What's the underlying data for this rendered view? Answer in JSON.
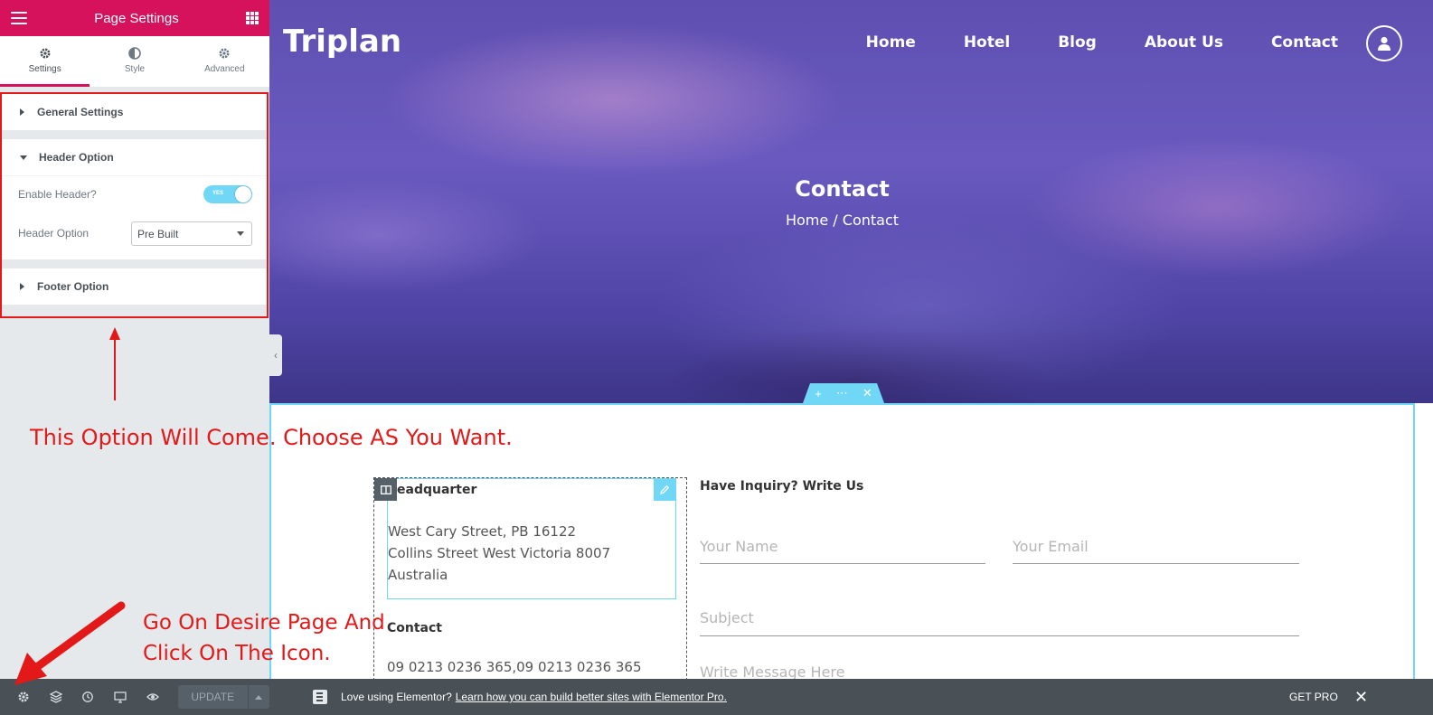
{
  "sidebar": {
    "title": "Page Settings",
    "tabs": [
      {
        "label": "Settings"
      },
      {
        "label": "Style"
      },
      {
        "label": "Advanced"
      }
    ],
    "sections": {
      "general": "General Settings",
      "header": "Header Option",
      "footer": "Footer Option"
    },
    "controls": {
      "enable_header_label": "Enable Header?",
      "enable_header_toggle": "YES",
      "header_option_label": "Header Option",
      "header_option_value": "Pre Built"
    },
    "footer_bar": {
      "update_label": "UPDATE"
    }
  },
  "annotations": {
    "option_note": "This Option Will Come. Choose AS You Want.",
    "icon_note_line1": "Go On Desire Page And",
    "icon_note_line2": "Click On The Icon.",
    "color": "#e31818"
  },
  "site": {
    "logo": "Triplan",
    "nav": [
      "Home",
      "Hotel",
      "Blog",
      "About Us",
      "Contact"
    ],
    "hero_title": "Contact",
    "breadcrumb": "Home / Contact"
  },
  "contact": {
    "hq_title": "eadquarter",
    "hq_lines": [
      "West Cary Street, PB 16122",
      "Collins Street West Victoria 8007",
      "Australia"
    ],
    "contact_title": "Contact",
    "phones": "09 0213 0236 365,09 0213 0236 365"
  },
  "form": {
    "title": "Have Inquiry? Write Us",
    "name_placeholder": "Your Name",
    "email_placeholder": "Your Email",
    "subject_placeholder": "Subject",
    "message_placeholder": "Write Message Here"
  },
  "notice": {
    "text": "Love using Elementor?",
    "link": "Learn how you can build better sites with Elementor Pro.",
    "get_pro": "GET PRO"
  },
  "colors": {
    "brand": "#d5125b",
    "accent": "#71d7f7",
    "panel_dark": "#495157"
  }
}
